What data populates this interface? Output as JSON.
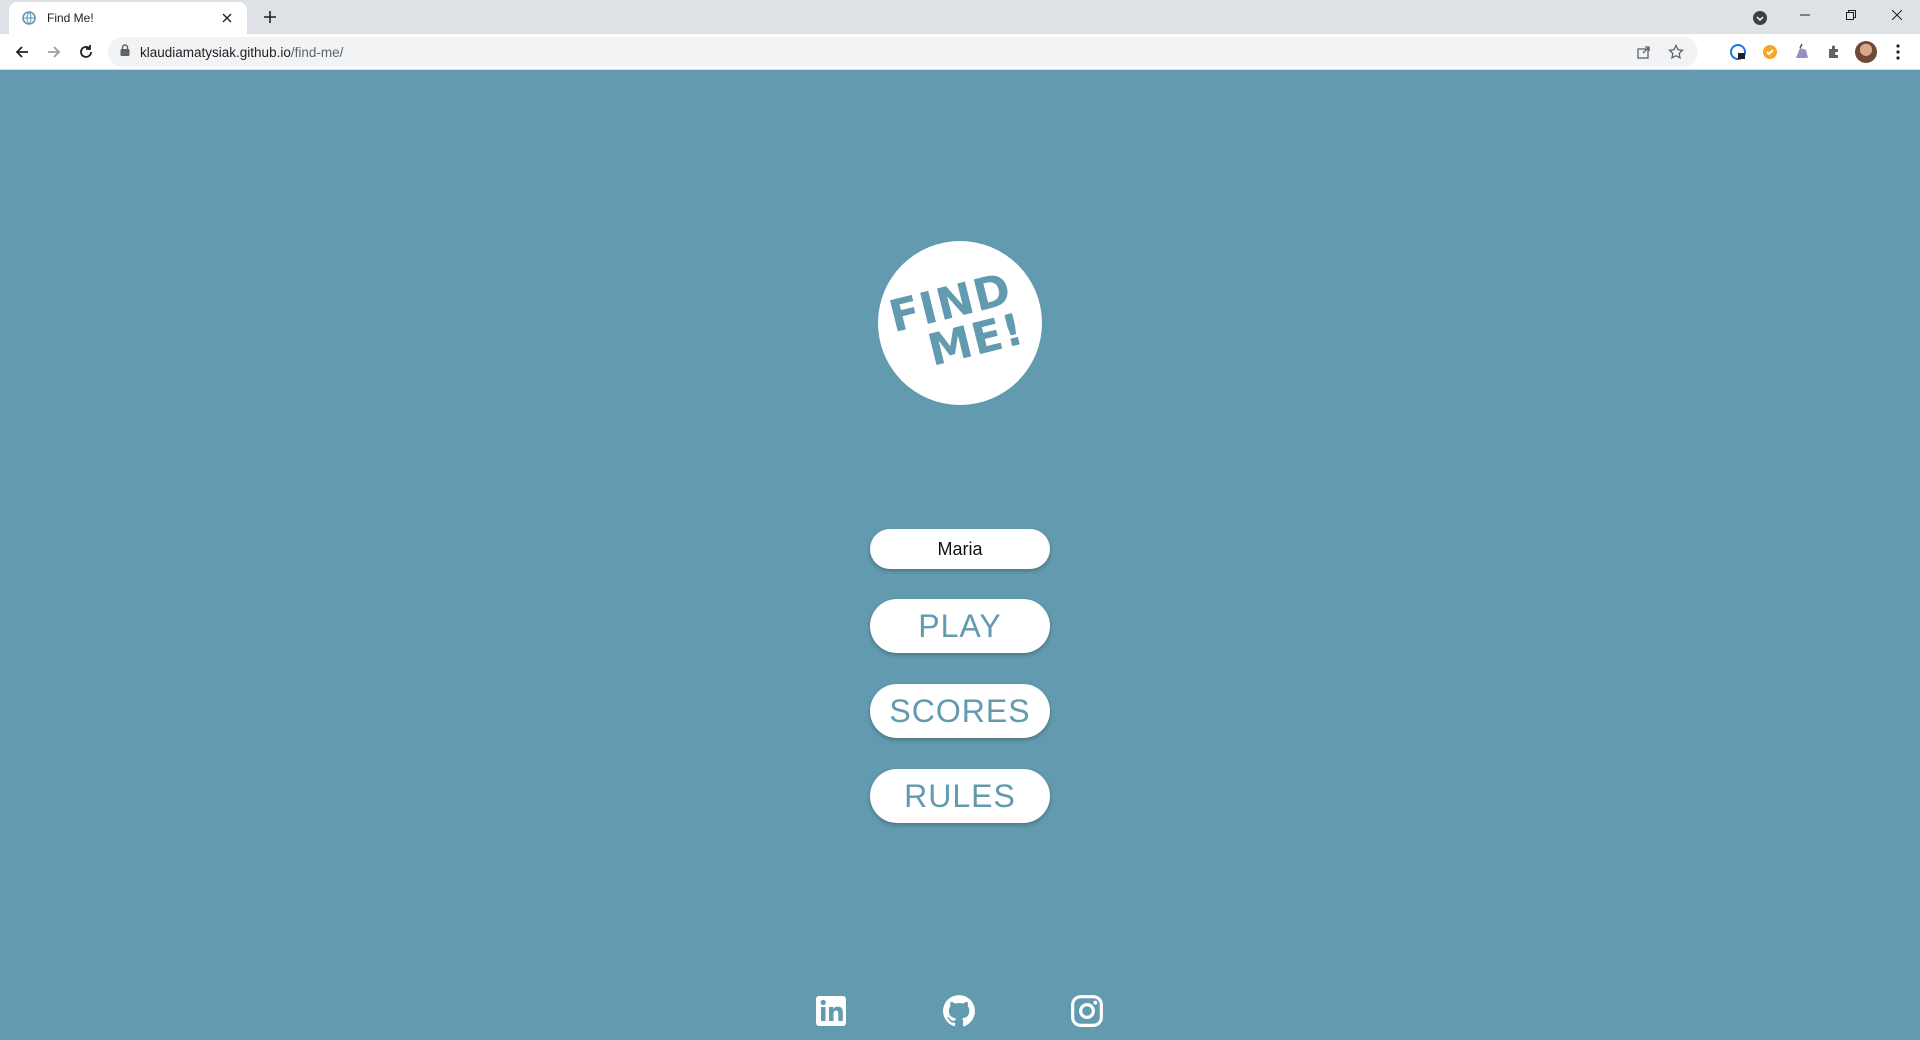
{
  "browser": {
    "tab": {
      "title": "Find Me!",
      "favicon": "globe-icon"
    },
    "address": {
      "host": "klaudiamatysiak.github.io",
      "path": "/find-me/"
    },
    "icons": [
      "back-icon",
      "forward-icon",
      "reload-icon",
      "lock-icon",
      "share-icon",
      "star-icon",
      "extensions-icon",
      "menu-icon"
    ]
  },
  "logo": {
    "line1": "FIND",
    "line2": "ME!"
  },
  "menu": {
    "name_value": "Maria",
    "play_label": "PLAY",
    "scores_label": "SCORES",
    "rules_label": "RULES"
  },
  "socials": [
    "linkedin-icon",
    "github-icon",
    "instagram-icon"
  ],
  "colors": {
    "background": "#629aaf",
    "button_text": "#629aaf",
    "button_bg": "#ffffff"
  }
}
